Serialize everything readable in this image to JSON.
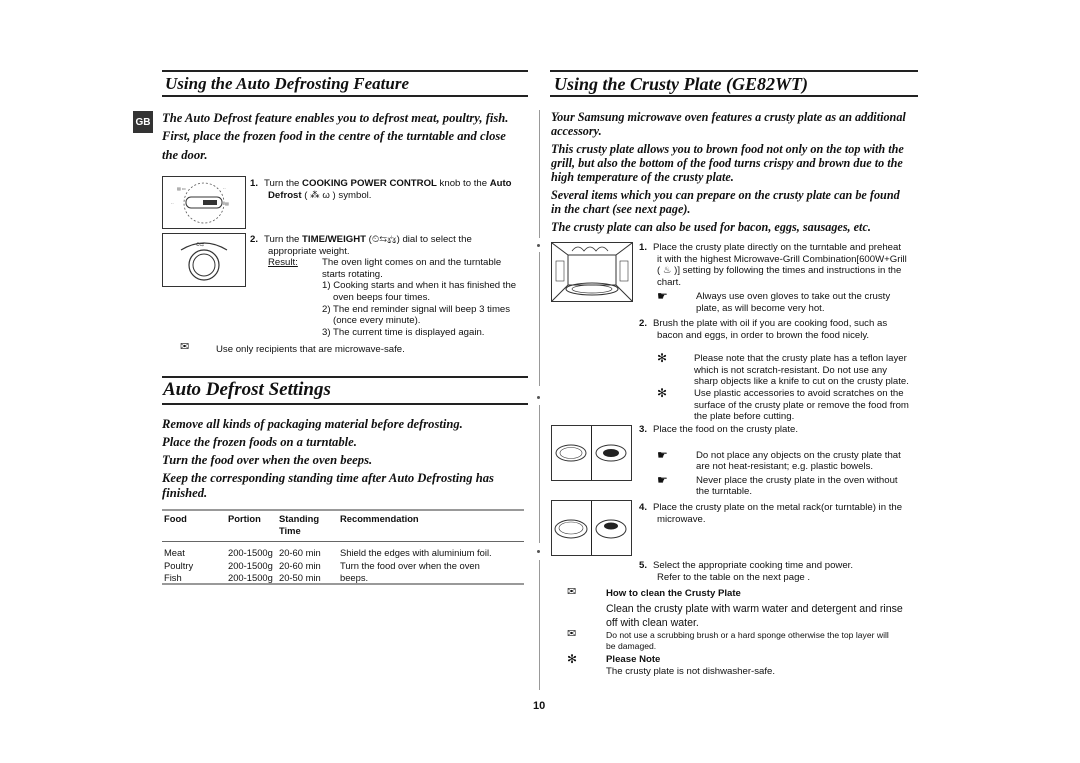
{
  "left": {
    "section_badge": "GB",
    "title": "Using the Auto Defrosting Feature",
    "intro_lines": [
      "The Auto Defrost feature enables you to defrost meat, poultry, fish.",
      "First, place the frozen food in the centre of the turntable and close",
      "the door."
    ],
    "steps": [
      {
        "num": "1.",
        "parts": [
          "Turn the ",
          "COOKING POWER CONTROL",
          " knob to the ",
          "Auto",
          "Defrost",
          " ( ⁂ ω ) symbol."
        ]
      },
      {
        "num": "2.",
        "line1_pre": "Turn the ",
        "line1_bold": "TIME/WEIGHT",
        "line1_post": " (⏲⇆⚖) dial to select the",
        "line2": "appropriate weight.",
        "result_label": "Result:",
        "result_text1": "The oven light comes on and the turntable",
        "result_text2": "starts rotating.",
        "sub_items": [
          [
            "1)  Cooking starts and when it has finished the",
            "oven beeps four times."
          ],
          [
            "2) The end reminder signal will beep 3 times",
            "(once every minute)."
          ],
          [
            "3) The current time is displayed again."
          ]
        ]
      }
    ],
    "note": "Use only recipients that are microwave-safe.",
    "settings_title": "Auto Defrost Settings",
    "settings_intro": [
      "Remove all kinds of packaging material before defrosting.",
      "Place the frozen foods on a turntable.",
      "Turn the food over when the oven beeps.",
      "Keep the corresponding standing time after Auto Defrosting has",
      "finished."
    ],
    "table": {
      "headers": [
        "Food",
        "Portion",
        "Standing Time",
        "Recommendation"
      ],
      "rows": [
        [
          "Meat",
          "200-1500g",
          "20-60 min",
          "Shield the edges with aluminium foil."
        ],
        [
          "Poultry",
          "200-1500g",
          "20-60 min",
          "Turn the food over when the oven"
        ],
        [
          "Fish",
          "200-1500g",
          "20-50 min",
          "beeps."
        ]
      ]
    }
  },
  "right": {
    "title": "Using the Crusty Plate (GE82WT)",
    "intro_paragraphs": [
      [
        "Your Samsung microwave oven features a crusty plate as an additional",
        "accessory."
      ],
      [
        "This crusty plate allows you to brown food not only on the top with the",
        "grill, but also the bottom of the food turns crispy and brown due to the",
        "high temperature of the crusty plate."
      ],
      [
        "Several items which you can prepare on the crusty plate can be found",
        "in the chart (see next page)."
      ],
      [
        "The crusty plate can also be used for bacon, eggs, sausages, etc."
      ]
    ],
    "step1": {
      "num": "1.",
      "lines": [
        "Place the crusty plate directly on the turntable and preheat",
        "it with the highest Microwave-Grill Combination[600W+Grill",
        "( ♨ )] setting by following the times and instructions in the",
        "chart."
      ],
      "hand_note": [
        "Always use oven gloves to take out the crusty",
        "plate, as will become very hot."
      ]
    },
    "step2": {
      "num": "2.",
      "lines": [
        "Brush the plate with oil if you are cooking food, such as",
        "bacon and eggs, in order to brown the food nicely."
      ]
    },
    "star_notes": [
      [
        "Please note that the crusty plate has a teflon layer",
        "which is not scratch-resistant. Do not use any",
        "sharp objects like a knife to cut on the crusty plate."
      ],
      [
        "Use plastic accessories to avoid scratches on the",
        "surface of the crusty plate or remove the food from",
        "the plate before cutting."
      ]
    ],
    "step3": {
      "num": "3.",
      "text": "Place the food on the crusty plate.",
      "hand_notes": [
        [
          "Do not place any objects on the crusty plate that",
          "are not heat-resistant; e.g. plastic bowels."
        ],
        [
          "Never place the crusty plate in the oven without",
          "the turntable."
        ]
      ]
    },
    "step4": {
      "num": "4.",
      "lines": [
        "Place the crusty plate on the metal rack(or turntable) in the",
        "microwave."
      ]
    },
    "step5": {
      "num": "5.",
      "lines": [
        "Select the appropriate cooking time and power.",
        "Refer to the table on the next page ."
      ]
    },
    "clean_title": "How to clean the Crusty Plate",
    "clean_text": [
      " Clean the crusty plate with warm water and detergent and rinse",
      "off with clean water."
    ],
    "scrub_note": [
      "Do not use a scrubbing brush or a hard sponge otherwise the top layer will",
      "be damaged."
    ],
    "please_note_title": "Please Note",
    "please_note_text": "The crusty plate is not dishwasher-safe."
  },
  "page_number": "10",
  "icons": {
    "note": "✉",
    "star": "✻",
    "hand": "☛"
  }
}
